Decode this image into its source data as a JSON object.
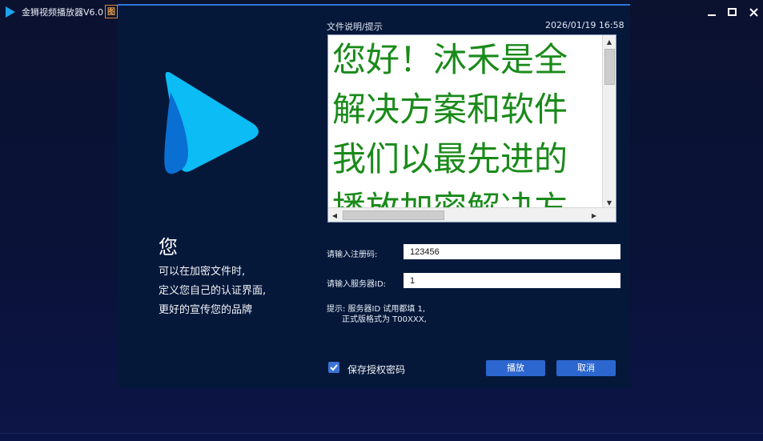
{
  "window": {
    "title": "金狮视频播放器V6.0",
    "badge": "图",
    "controls": {
      "minimize_icon": "minimize-icon",
      "maximize_icon": "maximize-icon",
      "close_icon": "close-icon"
    }
  },
  "left_panel": {
    "logo_icon": "play-logo-icon",
    "big_char": "您",
    "lines": [
      "可以在加密文件时,",
      "定义您自己的认证界面,",
      "更好的宣传您的品牌"
    ]
  },
  "info": {
    "hint_title": "文件说明/提示",
    "datetime": "2026/01/19 16:58",
    "text_lines": [
      "您好！沐禾是全",
      "解决方案和软件",
      "我们以最先进的",
      "播放加密解决方"
    ]
  },
  "form": {
    "reg_label": "请输入注册码:",
    "reg_value": "123456",
    "server_label": "请输入服务器ID:",
    "server_value": "1",
    "tip_line1": "提示: 服务器ID 试用都填 1,",
    "tip_line2": "正式版格式为 T00XXX,"
  },
  "footer": {
    "save_label": "保存授权密码",
    "save_checked": true,
    "play_label": "播放",
    "cancel_label": "取消"
  },
  "colors": {
    "accent": "#2c66cf",
    "text_green": "#1a8a1a",
    "dialog_bg": "#06183a",
    "logo_blue": "#0bb8f5"
  }
}
